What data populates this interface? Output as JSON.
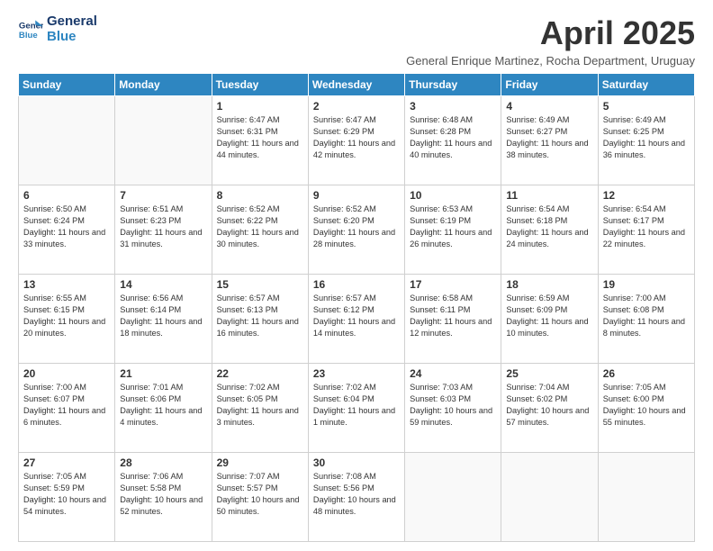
{
  "header": {
    "logo_line1": "General",
    "logo_line2": "Blue",
    "month": "April 2025",
    "location": "General Enrique Martinez, Rocha Department, Uruguay"
  },
  "days_of_week": [
    "Sunday",
    "Monday",
    "Tuesday",
    "Wednesday",
    "Thursday",
    "Friday",
    "Saturday"
  ],
  "weeks": [
    [
      {
        "day": "",
        "content": ""
      },
      {
        "day": "",
        "content": ""
      },
      {
        "day": "1",
        "content": "Sunrise: 6:47 AM\nSunset: 6:31 PM\nDaylight: 11 hours and 44 minutes."
      },
      {
        "day": "2",
        "content": "Sunrise: 6:47 AM\nSunset: 6:29 PM\nDaylight: 11 hours and 42 minutes."
      },
      {
        "day": "3",
        "content": "Sunrise: 6:48 AM\nSunset: 6:28 PM\nDaylight: 11 hours and 40 minutes."
      },
      {
        "day": "4",
        "content": "Sunrise: 6:49 AM\nSunset: 6:27 PM\nDaylight: 11 hours and 38 minutes."
      },
      {
        "day": "5",
        "content": "Sunrise: 6:49 AM\nSunset: 6:25 PM\nDaylight: 11 hours and 36 minutes."
      }
    ],
    [
      {
        "day": "6",
        "content": "Sunrise: 6:50 AM\nSunset: 6:24 PM\nDaylight: 11 hours and 33 minutes."
      },
      {
        "day": "7",
        "content": "Sunrise: 6:51 AM\nSunset: 6:23 PM\nDaylight: 11 hours and 31 minutes."
      },
      {
        "day": "8",
        "content": "Sunrise: 6:52 AM\nSunset: 6:22 PM\nDaylight: 11 hours and 30 minutes."
      },
      {
        "day": "9",
        "content": "Sunrise: 6:52 AM\nSunset: 6:20 PM\nDaylight: 11 hours and 28 minutes."
      },
      {
        "day": "10",
        "content": "Sunrise: 6:53 AM\nSunset: 6:19 PM\nDaylight: 11 hours and 26 minutes."
      },
      {
        "day": "11",
        "content": "Sunrise: 6:54 AM\nSunset: 6:18 PM\nDaylight: 11 hours and 24 minutes."
      },
      {
        "day": "12",
        "content": "Sunrise: 6:54 AM\nSunset: 6:17 PM\nDaylight: 11 hours and 22 minutes."
      }
    ],
    [
      {
        "day": "13",
        "content": "Sunrise: 6:55 AM\nSunset: 6:15 PM\nDaylight: 11 hours and 20 minutes."
      },
      {
        "day": "14",
        "content": "Sunrise: 6:56 AM\nSunset: 6:14 PM\nDaylight: 11 hours and 18 minutes."
      },
      {
        "day": "15",
        "content": "Sunrise: 6:57 AM\nSunset: 6:13 PM\nDaylight: 11 hours and 16 minutes."
      },
      {
        "day": "16",
        "content": "Sunrise: 6:57 AM\nSunset: 6:12 PM\nDaylight: 11 hours and 14 minutes."
      },
      {
        "day": "17",
        "content": "Sunrise: 6:58 AM\nSunset: 6:11 PM\nDaylight: 11 hours and 12 minutes."
      },
      {
        "day": "18",
        "content": "Sunrise: 6:59 AM\nSunset: 6:09 PM\nDaylight: 11 hours and 10 minutes."
      },
      {
        "day": "19",
        "content": "Sunrise: 7:00 AM\nSunset: 6:08 PM\nDaylight: 11 hours and 8 minutes."
      }
    ],
    [
      {
        "day": "20",
        "content": "Sunrise: 7:00 AM\nSunset: 6:07 PM\nDaylight: 11 hours and 6 minutes."
      },
      {
        "day": "21",
        "content": "Sunrise: 7:01 AM\nSunset: 6:06 PM\nDaylight: 11 hours and 4 minutes."
      },
      {
        "day": "22",
        "content": "Sunrise: 7:02 AM\nSunset: 6:05 PM\nDaylight: 11 hours and 3 minutes."
      },
      {
        "day": "23",
        "content": "Sunrise: 7:02 AM\nSunset: 6:04 PM\nDaylight: 11 hours and 1 minute."
      },
      {
        "day": "24",
        "content": "Sunrise: 7:03 AM\nSunset: 6:03 PM\nDaylight: 10 hours and 59 minutes."
      },
      {
        "day": "25",
        "content": "Sunrise: 7:04 AM\nSunset: 6:02 PM\nDaylight: 10 hours and 57 minutes."
      },
      {
        "day": "26",
        "content": "Sunrise: 7:05 AM\nSunset: 6:00 PM\nDaylight: 10 hours and 55 minutes."
      }
    ],
    [
      {
        "day": "27",
        "content": "Sunrise: 7:05 AM\nSunset: 5:59 PM\nDaylight: 10 hours and 54 minutes."
      },
      {
        "day": "28",
        "content": "Sunrise: 7:06 AM\nSunset: 5:58 PM\nDaylight: 10 hours and 52 minutes."
      },
      {
        "day": "29",
        "content": "Sunrise: 7:07 AM\nSunset: 5:57 PM\nDaylight: 10 hours and 50 minutes."
      },
      {
        "day": "30",
        "content": "Sunrise: 7:08 AM\nSunset: 5:56 PM\nDaylight: 10 hours and 48 minutes."
      },
      {
        "day": "",
        "content": ""
      },
      {
        "day": "",
        "content": ""
      },
      {
        "day": "",
        "content": ""
      }
    ]
  ]
}
